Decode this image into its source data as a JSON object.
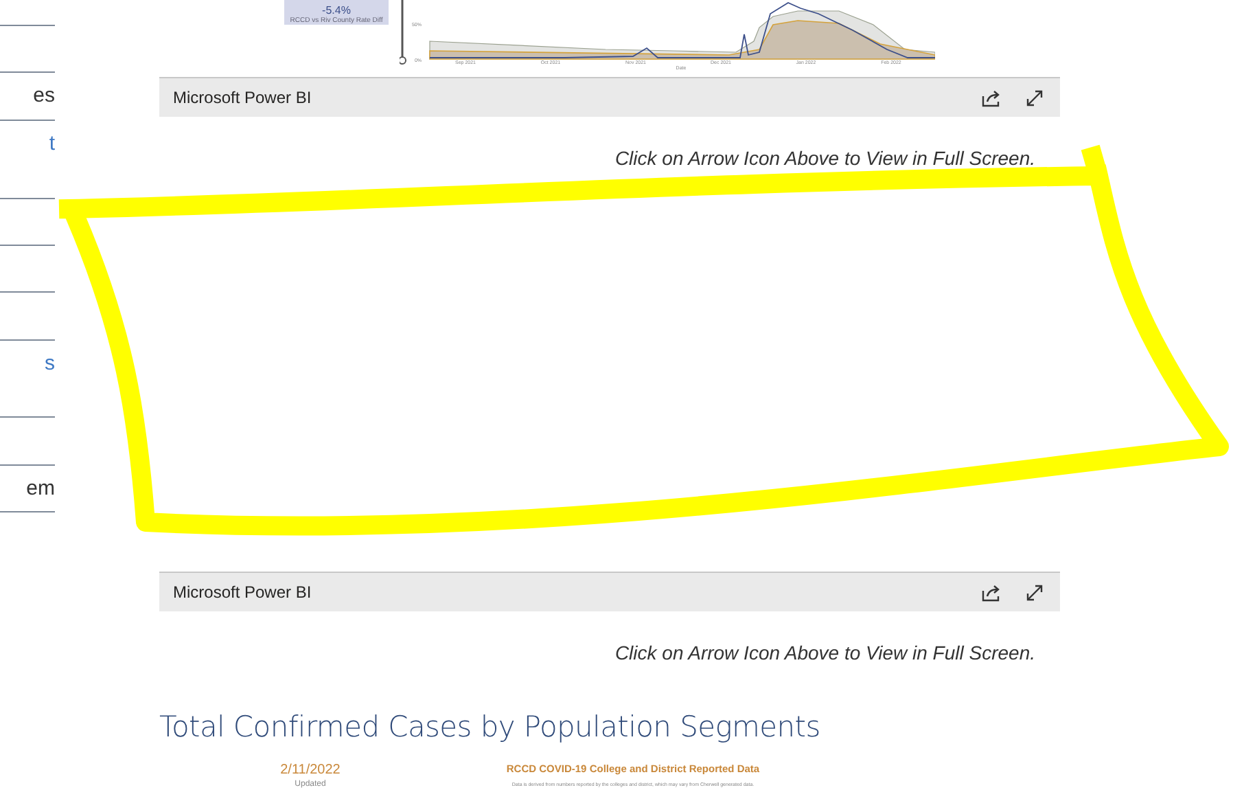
{
  "sidebar": {
    "items": [
      {
        "kind": "blank"
      },
      {
        "kind": "blank"
      },
      {
        "kind": "text",
        "label": "es",
        "link": false
      },
      {
        "kind": "text",
        "label": "t",
        "link": true
      },
      {
        "kind": "blank"
      },
      {
        "kind": "blank"
      },
      {
        "kind": "blank"
      },
      {
        "kind": "text",
        "label": "s",
        "link": true
      },
      {
        "kind": "blank"
      },
      {
        "kind": "text",
        "label": "em",
        "link": false
      }
    ]
  },
  "top_report": {
    "kpi_value": "-5.4%",
    "kpi_caption": "RCCD vs Riv County Rate Diff",
    "y_ticks": [
      "50%",
      "0%"
    ],
    "x_ticks": [
      "Sep 2021",
      "Oct 2021",
      "Nov 2021",
      "Dec 2021",
      "Jan 2022",
      "Feb 2022"
    ],
    "x_label": "Date"
  },
  "embeds": [
    {
      "brand": "Microsoft Power BI",
      "caption": "Click on Arrow Icon Above to View in Full Screen."
    },
    {
      "brand": "Microsoft Power BI",
      "caption": "Click on Arrow Icon Above to View in Full Screen."
    }
  ],
  "section_heading": "Total Confirmed Cases by Population Segments",
  "bottom_report": {
    "date": "2/11/2022",
    "date_label": "Updated",
    "title": "RCCD COVID-19 College and District Reported Data",
    "note": "Data is derived from numbers reported by the colleges and district, which may vary from Cherwell generated data."
  }
}
